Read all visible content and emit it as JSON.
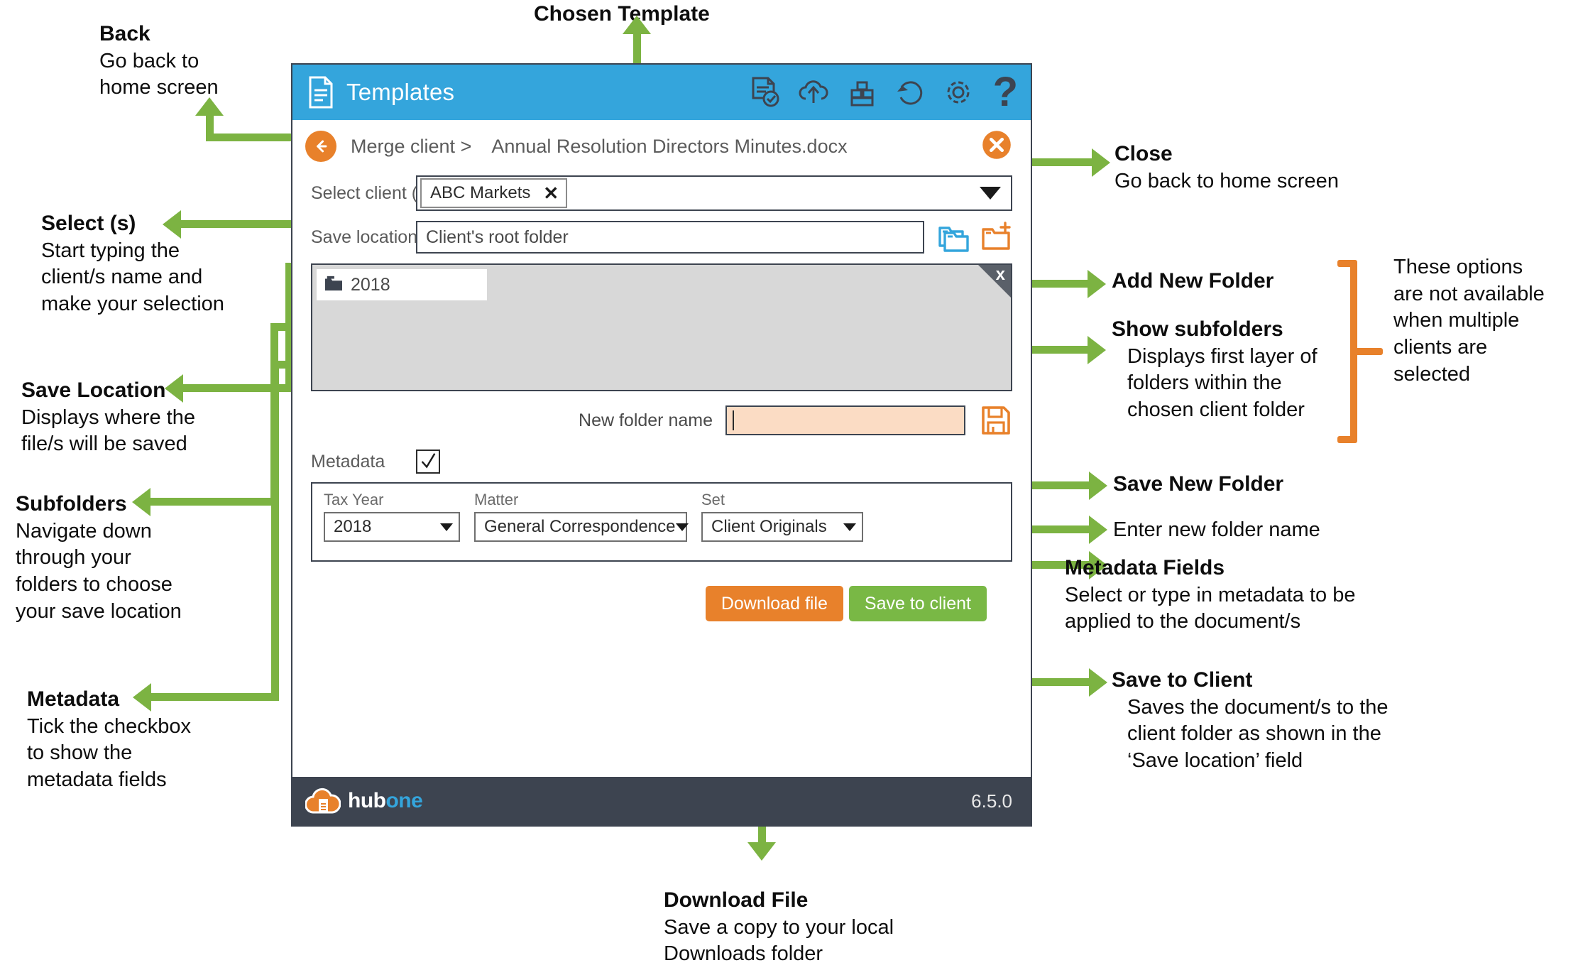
{
  "app": {
    "title": "Templates",
    "toolbar_icons": [
      {
        "name": "document-check-icon"
      },
      {
        "name": "cloud-upload-icon"
      },
      {
        "name": "blocks-icon"
      },
      {
        "name": "refresh-icon"
      },
      {
        "name": "gear-icon"
      },
      {
        "name": "help-icon",
        "glyph": "?"
      }
    ],
    "breadcrumb": {
      "back_icon": "back-arrow-icon",
      "parent": "Merge client >",
      "file": "Annual Resolution Directors Minutes.docx",
      "close_icon": "close-icon"
    },
    "select_client": {
      "label": "Select client (s)",
      "chip_value": "ABC Markets",
      "chip_remove": "✕",
      "dropdown_icon": "chevron-down-icon"
    },
    "save_location": {
      "label": "Save location",
      "value": "Client's root folder",
      "show_subfolders_icon": "folders-icon",
      "add_new_folder_icon": "add-folder-icon"
    },
    "subfolders": {
      "items": [
        {
          "name": "2018",
          "icon": "folder-icon"
        }
      ],
      "close_glyph": "x"
    },
    "new_folder": {
      "label": "New folder name",
      "value": "",
      "save_icon": "floppy-save-icon"
    },
    "metadata": {
      "label": "Metadata",
      "checked": true,
      "check_glyph": "✓",
      "fields": [
        {
          "title": "Tax Year",
          "value": "2018"
        },
        {
          "title": "Matter",
          "value": "General Correspondence"
        },
        {
          "title": "Set",
          "value": "Client Originals"
        }
      ]
    },
    "actions": {
      "download": "Download file",
      "save_to_client": "Save to client"
    },
    "footer": {
      "brand_first": "hub",
      "brand_second": "one",
      "version": "6.5.0",
      "logo_icon": "hubone-cloud-logo"
    }
  },
  "annotations": {
    "chosen_template": {
      "title": "Chosen Template"
    },
    "back": {
      "title": "Back",
      "body": "Go back to\nhome screen"
    },
    "select": {
      "title": "Select (s)",
      "body": "Start typing the\nclient/s name and\nmake your selection"
    },
    "save_location": {
      "title": "Save Location",
      "body": "Displays where the\nfile/s will be saved"
    },
    "subfolders": {
      "title": "Subfolders",
      "body": "Navigate down\nthrough your\nfolders to choose\nyour save location"
    },
    "metadata": {
      "title": "Metadata",
      "body": "Tick the checkbox\nto show the\nmetadata fields"
    },
    "close": {
      "title": "Close",
      "body": "Go back to home screen"
    },
    "add_new_folder": {
      "title": "Add New Folder",
      "body": ""
    },
    "show_subfolders": {
      "title": "Show subfolders",
      "body": "Displays first layer of\nfolders within the\nchosen client folder"
    },
    "multi_note": {
      "title": "",
      "body": "These options\nare not available\nwhen multiple\nclients are\nselected"
    },
    "save_new_folder": {
      "title": "Save New Folder",
      "body": ""
    },
    "enter_folder_name": {
      "title": "",
      "body": "Enter new folder name"
    },
    "metadata_fields": {
      "title": "Metadata Fields",
      "body": "Select or type in metadata to be\napplied to the document/s"
    },
    "save_to_client": {
      "title": "Save to Client",
      "body": "Saves the document/s to the\nclient folder as shown in the\n‘Save location’ field"
    },
    "download_file": {
      "title": "Download File",
      "body": "Save a copy to your local\nDownloads folder"
    }
  },
  "colors": {
    "header_blue": "#34a5dc",
    "orange": "#e8812b",
    "green_button": "#79b845",
    "arrow_green": "#7cb342",
    "dark_slate": "#3d4450",
    "panel_grey": "#d8d8d8",
    "input_peach": "#fbdcc4"
  }
}
